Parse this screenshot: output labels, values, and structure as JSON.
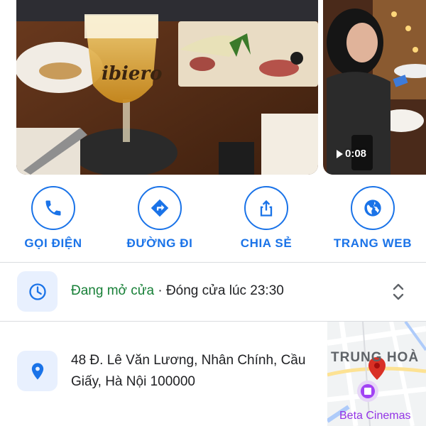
{
  "photos": {
    "main_alt": "Restaurant table with beer glass",
    "glass_brand": "ibiero",
    "video_duration": "0:08"
  },
  "actions": [
    {
      "label": "GỌI ĐIỆN",
      "icon": "phone-icon"
    },
    {
      "label": "ĐƯỜNG ĐI",
      "icon": "directions-icon"
    },
    {
      "label": "CHIA SẺ",
      "icon": "share-icon"
    },
    {
      "label": "TRANG WEB",
      "icon": "globe-icon"
    }
  ],
  "hours": {
    "icon": "clock-icon",
    "status": "Đang mở cửa",
    "separator": " · ",
    "closing": "Đóng cửa lúc 23:30"
  },
  "address": {
    "icon": "location-pin-icon",
    "text": "48 Đ. Lê Văn Lương, Nhân Chính, Cầu Giấy, Hà Nội 100000"
  },
  "map": {
    "area_label": "TRUNG HOÀ",
    "poi_label": "Beta Cinemas"
  },
  "colors": {
    "accent": "#1a73e8",
    "open": "#188038",
    "icon_bg": "#e8f0fe",
    "pin": "#d93025",
    "poi": "#9334e6"
  }
}
